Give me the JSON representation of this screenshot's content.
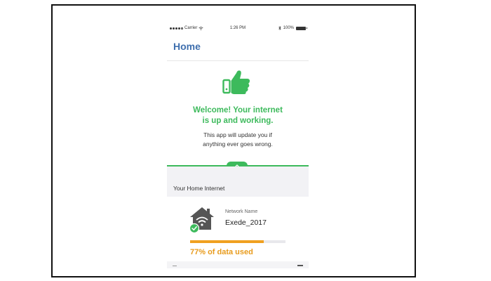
{
  "status_bar": {
    "carrier": "Carrier",
    "time": "1:26 PM",
    "battery": "100%"
  },
  "header": {
    "title": "Home"
  },
  "hero": {
    "title_line1": "Welcome! Your internet",
    "title_line2": "is up and working.",
    "subtitle_line1": "This app will update you if",
    "subtitle_line2": "anything ever goes wrong."
  },
  "section": {
    "label": "Your Home Internet"
  },
  "network": {
    "name_label": "Network Name",
    "name_value": "Exede_2017",
    "usage_text": "77% of data used",
    "usage_fraction": 0.77
  },
  "colors": {
    "brand_blue": "#3f6fae",
    "success_green": "#3dba5c",
    "usage_orange": "#f0a020",
    "section_gray": "#f2f2f5"
  },
  "icons": [
    "thumbs-up-icon",
    "chevron-up-icon",
    "house-wifi-icon",
    "check-badge-icon",
    "wifi-icon",
    "bluetooth-icon",
    "battery-icon"
  ]
}
